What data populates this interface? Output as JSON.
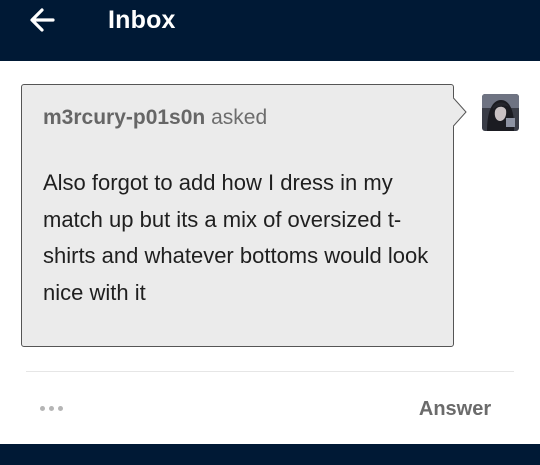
{
  "header": {
    "back_icon": "arrow-left-icon",
    "title": "Inbox",
    "background_color": "#001935"
  },
  "message": {
    "asker_name": "m3rcury-p01s0n",
    "asked_label": "asked",
    "question": "Also forgot to add how I dress in my match up but its a mix of oversized t-shirts and whatever bottoms would look nice with it",
    "bubble_color": "#ebebeb"
  },
  "actions": {
    "more_icon": "ellipsis-icon",
    "answer_label": "Answer"
  }
}
